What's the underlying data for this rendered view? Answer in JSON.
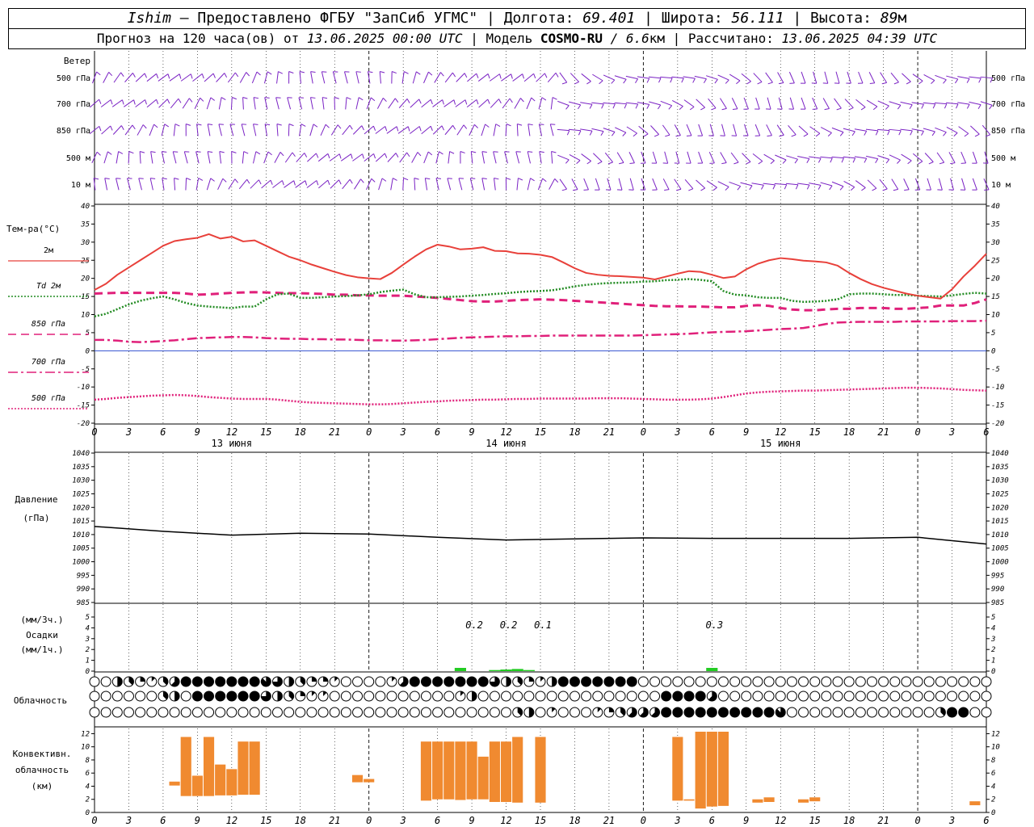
{
  "header": {
    "line1": {
      "station": "Ishim",
      "provider": " — Предоставлено ФГБУ \"ЗапСиб УГМС\" | Долгота: ",
      "lon": "69.401",
      "lat_label": " | Широта: ",
      "lat": "56.111",
      "alt_label": " | Высота: ",
      "alt": "89",
      "alt_unit": "м"
    },
    "line2": {
      "prefix": "Прогноз на 120 часа(ов) от ",
      "issued": "13.06.2025 00:00 UTC",
      "model_label": "  | Модель ",
      "model": "COSMO-RU",
      "res": " / 6.6",
      "res_unit": "км",
      "calc_label": " | Рассчитано: ",
      "calc_time": "13.06.2025 04:39 UTC"
    }
  },
  "wind_panel": {
    "title": "Ветер",
    "levels": [
      "500 гПа",
      "700 гПа",
      "850 гПа",
      "500 м",
      "10  м"
    ]
  },
  "temp_panel": {
    "title": "Тем-ра(°C)",
    "legend": [
      {
        "label": "2м",
        "color": "#e8403a",
        "style": "solid"
      },
      {
        "label": "Td  2м",
        "color": "#228b22",
        "style": "dotted"
      },
      {
        "label": "850 гПа",
        "color": "#e0207a",
        "style": "dashed"
      },
      {
        "label": "700 гПа",
        "color": "#e0207a",
        "style": "dashdot"
      },
      {
        "label": "500 гПа",
        "color": "#e0207a",
        "style": "dotted"
      }
    ],
    "yticks": [
      40,
      35,
      30,
      25,
      20,
      15,
      10,
      5,
      0,
      -5,
      -10,
      -15,
      -20
    ],
    "xticks": [
      "0",
      "3",
      "6",
      "9",
      "12",
      "15",
      "18",
      "21",
      "0",
      "3",
      "6",
      "9",
      "12",
      "15",
      "18",
      "21",
      "0",
      "3",
      "6",
      "9",
      "12",
      "15",
      "18",
      "21",
      "0",
      "3",
      "6"
    ],
    "dates": [
      "13 июня",
      "14 июня",
      "15 июня"
    ]
  },
  "pressure_panel": {
    "title": "Давление",
    "unit": "(гПа)",
    "yticks": [
      1040,
      1035,
      1030,
      1025,
      1020,
      1015,
      1010,
      1005,
      1000,
      995,
      990,
      985
    ]
  },
  "precip_panel": {
    "title1": "(мм/3ч.)",
    "title2": "Осадки",
    "title3": "(мм/1ч.)",
    "yticks": [
      5,
      4,
      3,
      2,
      1,
      0
    ],
    "labels": [
      {
        "hour": 33,
        "text": "0.2"
      },
      {
        "hour": 36,
        "text": "0.2"
      },
      {
        "hour": 39,
        "text": "0.1"
      },
      {
        "hour": 54,
        "text": "0.3"
      }
    ]
  },
  "cloud_panel": {
    "title": "Облачность"
  },
  "conv_panel": {
    "title1": "Конвективн.",
    "title2": "облачность",
    "title3": "(км)",
    "yticks": [
      12,
      10,
      8,
      6,
      4,
      2,
      0
    ]
  },
  "colors": {
    "wind": "#7a22c4",
    "t2m": "#e8403a",
    "td": "#228b22",
    "upper": "#e0207a",
    "pressure": "#000000",
    "precip": "#22cc22",
    "conv": "#f08a30",
    "zero_line": "#3050d0"
  },
  "chart_data": [
    {
      "type": "line",
      "title": "Тем-ра(°C)",
      "xlabel": "",
      "ylabel": "Тем-ра(°C)",
      "ylim": [
        -20,
        40
      ],
      "x": [
        0,
        1,
        2,
        3,
        4,
        5,
        6,
        7,
        8,
        9,
        10,
        11,
        12,
        13,
        14,
        15,
        16,
        17,
        18,
        19,
        20,
        21,
        22,
        23,
        24,
        25,
        26,
        27,
        28,
        29,
        30,
        31,
        32,
        33,
        34,
        35,
        36,
        37,
        38,
        39,
        40,
        41,
        42,
        43,
        44,
        45,
        46,
        47,
        48,
        49,
        50,
        51,
        52,
        53,
        54,
        55,
        56,
        57,
        58,
        59,
        60,
        61,
        62,
        63,
        64,
        65,
        66,
        67,
        68,
        69,
        70,
        71,
        72,
        73,
        74,
        75,
        76,
        77,
        78
      ],
      "series": [
        {
          "name": "2м",
          "values": [
            16.8,
            18.5,
            21,
            23,
            25,
            27,
            29,
            30.3,
            30.8,
            31.2,
            32.2,
            31,
            31.5,
            30.2,
            30.5,
            29,
            27.5,
            26,
            25,
            23.8,
            22.8,
            21.8,
            20.9,
            20.3,
            20,
            19.8,
            21.5,
            23.8,
            26,
            28,
            29.3,
            28.8,
            28,
            28.2,
            28.6,
            27.6,
            27.5,
            26.9,
            26.8,
            26.5,
            25.9,
            24.4,
            22.8,
            21.5,
            21,
            20.7,
            20.6,
            20.4,
            20.2,
            19.7,
            20.5,
            21.3,
            22,
            21.8,
            21,
            20.1,
            20.5,
            22.5,
            24,
            25,
            25.6,
            25.3,
            24.9,
            24.7,
            24.4,
            23.5,
            21.5,
            19.8,
            18.4,
            17.4,
            16.6,
            15.8,
            15.2,
            14.8,
            14.4,
            17,
            20.5,
            23.5,
            26.8
          ]
        },
        {
          "name": "Td  2м",
          "values": [
            9.5,
            10.2,
            11.5,
            12.8,
            13.8,
            14.5,
            15,
            14.2,
            13.2,
            12.5,
            12.2,
            12,
            11.8,
            12.2,
            12.2,
            14.2,
            15.6,
            15.8,
            14.6,
            14.6,
            14.8,
            15,
            15.1,
            15.3,
            15.6,
            16.2,
            16.6,
            16.9,
            15.6,
            14.8,
            14.8,
            14.9,
            15,
            15.2,
            15.4,
            15.7,
            15.9,
            16.2,
            16.4,
            16.5,
            16.7,
            17.2,
            17.8,
            18.2,
            18.5,
            18.7,
            18.8,
            18.9,
            19.1,
            19.2,
            19.5,
            19.6,
            19.8,
            19.6,
            19.2,
            16.5,
            15.5,
            15.3,
            14.8,
            14.6,
            14.6,
            13.8,
            13.5,
            13.6,
            13.8,
            14.2,
            15.6,
            15.8,
            15.8,
            15.6,
            15.4,
            15.4,
            15.2,
            15.1,
            15,
            15.3,
            15.7,
            16,
            15.8
          ]
        },
        {
          "name": "850 гПа",
          "values": [
            15.8,
            15.9,
            16,
            16,
            16,
            16,
            16,
            16,
            15.8,
            15.5,
            15.6,
            15.8,
            16,
            16.1,
            16.2,
            16.1,
            16,
            15.9,
            15.9,
            15.8,
            15.7,
            15.5,
            15.5,
            15.3,
            15.3,
            15.2,
            15.2,
            15.2,
            15,
            14.8,
            14.6,
            14.3,
            14,
            13.7,
            13.6,
            13.6,
            13.8,
            14,
            14.1,
            14.2,
            14.1,
            14,
            13.8,
            13.6,
            13.4,
            13.2,
            13,
            12.8,
            12.6,
            12.4,
            12.3,
            12.3,
            12.2,
            12.2,
            12.1,
            12,
            12,
            12.4,
            12.6,
            12.4,
            11.8,
            11.4,
            11.2,
            11.2,
            11.4,
            11.6,
            11.6,
            11.8,
            11.8,
            11.8,
            11.6,
            11.6,
            11.8,
            12,
            12.5,
            12.5,
            12.5,
            13.2,
            14.2
          ]
        },
        {
          "name": "700 гПа",
          "values": [
            3,
            3,
            2.8,
            2.5,
            2.4,
            2.5,
            2.7,
            2.9,
            3.2,
            3.5,
            3.6,
            3.7,
            3.8,
            3.8,
            3.7,
            3.5,
            3.4,
            3.3,
            3.3,
            3.2,
            3.2,
            3.1,
            3.1,
            3,
            2.9,
            2.9,
            2.8,
            2.8,
            2.9,
            3,
            3.2,
            3.4,
            3.6,
            3.7,
            3.8,
            3.9,
            4,
            4,
            4.1,
            4.1,
            4.2,
            4.2,
            4.2,
            4.2,
            4.2,
            4.2,
            4.2,
            4.2,
            4.3,
            4.4,
            4.5,
            4.6,
            4.7,
            4.9,
            5.1,
            5.2,
            5.3,
            5.4,
            5.6,
            5.8,
            6,
            6.1,
            6.3,
            6.8,
            7.4,
            7.8,
            7.9,
            8,
            8,
            8,
            8,
            8.1,
            8.1,
            8.1,
            8.1,
            8.2,
            8.2,
            8.2,
            8.3
          ]
        },
        {
          "name": "500 гПа",
          "values": [
            -13.5,
            -13.3,
            -13,
            -12.8,
            -12.6,
            -12.4,
            -12.3,
            -12.2,
            -12.3,
            -12.5,
            -12.8,
            -13,
            -13.2,
            -13.3,
            -13.3,
            -13.3,
            -13.5,
            -13.8,
            -14.1,
            -14.3,
            -14.4,
            -14.5,
            -14.6,
            -14.7,
            -14.8,
            -14.8,
            -14.7,
            -14.5,
            -14.3,
            -14.1,
            -14,
            -13.8,
            -13.7,
            -13.6,
            -13.5,
            -13.5,
            -13.4,
            -13.3,
            -13.3,
            -13.2,
            -13.2,
            -13.2,
            -13.2,
            -13.2,
            -13.1,
            -13.1,
            -13.1,
            -13.2,
            -13.3,
            -13.4,
            -13.5,
            -13.5,
            -13.5,
            -13.4,
            -13.2,
            -12.8,
            -12.3,
            -11.8,
            -11.5,
            -11.3,
            -11.2,
            -11.1,
            -11,
            -11,
            -10.9,
            -10.8,
            -10.7,
            -10.6,
            -10.5,
            -10.4,
            -10.3,
            -10.2,
            -10.2,
            -10.3,
            -10.4,
            -10.6,
            -10.8,
            -10.9,
            -11
          ]
        }
      ]
    },
    {
      "type": "line",
      "title": "Давление",
      "xlabel": "",
      "ylabel": "Давление (гПа)",
      "ylim": [
        985,
        1040
      ],
      "x": [
        0,
        6,
        12,
        18,
        24,
        30,
        36,
        42,
        48,
        54,
        60,
        66,
        72,
        78
      ],
      "series": [
        {
          "name": "Давление",
          "values": [
            1013,
            1011.2,
            1009.8,
            1010.5,
            1010.2,
            1009,
            1008,
            1008.4,
            1008.8,
            1008.6,
            1008.6,
            1008.6,
            1009,
            1006.5
          ]
        }
      ]
    },
    {
      "type": "bar",
      "title": "Осадки",
      "xlabel": "",
      "ylabel": "(мм/1ч.)",
      "ylim": [
        0,
        5
      ],
      "x": [
        32,
        35,
        36,
        37,
        38,
        54
      ],
      "values": [
        0.3,
        0.1,
        0.15,
        0.2,
        0.1,
        0.3
      ]
    },
    {
      "type": "bar",
      "title": "Конвективн. облачность",
      "xlabel": "",
      "ylabel": "(км)",
      "ylim": [
        0,
        12
      ],
      "x": [
        7,
        8,
        9,
        10,
        11,
        12,
        13,
        14,
        23,
        24,
        29,
        30,
        31,
        32,
        33,
        34,
        35,
        36,
        37,
        39,
        51,
        52,
        53,
        54,
        55,
        58,
        59,
        62,
        63,
        77
      ],
      "series": [
        {
          "name": "base",
          "values": [
            4.1,
            2.5,
            2.5,
            2.5,
            2.6,
            2.6,
            2.7,
            2.7,
            4.6,
            4.6,
            1.8,
            2,
            2,
            1.9,
            2,
            2,
            1.6,
            1.6,
            1.5,
            1.5,
            1.8,
            1.8,
            0.6,
            0.9,
            1,
            1.5,
            1.6,
            1.5,
            1.7,
            1.1
          ]
        },
        {
          "name": "top",
          "values": [
            4.7,
            11.5,
            5.6,
            11.5,
            7.3,
            6.6,
            10.8,
            10.8,
            5.7,
            5.1,
            10.8,
            10.8,
            10.8,
            10.8,
            10.8,
            8.5,
            10.8,
            10.8,
            11.5,
            11.5,
            11.5,
            2,
            12.3,
            12.3,
            12.3,
            2,
            2.3,
            2,
            2.3,
            1.7
          ]
        }
      ]
    },
    {
      "type": "table",
      "title": "Облачность",
      "note": "cloud cover octas per 3h step, rows: upper, middle, lower",
      "rows": [
        [
          0,
          0,
          4,
          3,
          2,
          1,
          3,
          5,
          8,
          8,
          8,
          8,
          8,
          8,
          8,
          7,
          6,
          4,
          3,
          2,
          2,
          1,
          0,
          0,
          0,
          0,
          1,
          5,
          8,
          8,
          8,
          8,
          8,
          8,
          8,
          6,
          4,
          3,
          2,
          1,
          4,
          8,
          8,
          8,
          8,
          8,
          8,
          8,
          0,
          0,
          0,
          0,
          0,
          0,
          0,
          0,
          0,
          0,
          0,
          0,
          0,
          0,
          0,
          0,
          0,
          0,
          0,
          0,
          0,
          0,
          0,
          0,
          0,
          0,
          0,
          0,
          0,
          0,
          0
        ],
        [
          0,
          0,
          0,
          0,
          0,
          0,
          3,
          4,
          0,
          8,
          8,
          8,
          8,
          8,
          8,
          6,
          4,
          3,
          2,
          1,
          1,
          0,
          0,
          0,
          0,
          0,
          0,
          0,
          0,
          0,
          0,
          0,
          1,
          4,
          0,
          0,
          0,
          0,
          0,
          0,
          0,
          0,
          0,
          0,
          0,
          0,
          0,
          0,
          0,
          0,
          8,
          8,
          8,
          8,
          5,
          0,
          0,
          0,
          0,
          0,
          0,
          0,
          0,
          0,
          0,
          0,
          0,
          0,
          0,
          0,
          0,
          0,
          0,
          0,
          0,
          0,
          0,
          0,
          0
        ],
        [
          0,
          0,
          0,
          0,
          0,
          0,
          0,
          0,
          0,
          0,
          0,
          0,
          0,
          0,
          0,
          0,
          0,
          0,
          0,
          0,
          0,
          0,
          0,
          0,
          0,
          0,
          0,
          0,
          0,
          0,
          0,
          0,
          0,
          0,
          0,
          0,
          0,
          3,
          4,
          0,
          1,
          0,
          0,
          0,
          1,
          2,
          3,
          5,
          5,
          5,
          8,
          8,
          8,
          8,
          8,
          8,
          8,
          8,
          8,
          8,
          7,
          0,
          0,
          0,
          0,
          0,
          0,
          0,
          0,
          0,
          0,
          0,
          0,
          0,
          3,
          8,
          8,
          0,
          0
        ]
      ]
    }
  ]
}
